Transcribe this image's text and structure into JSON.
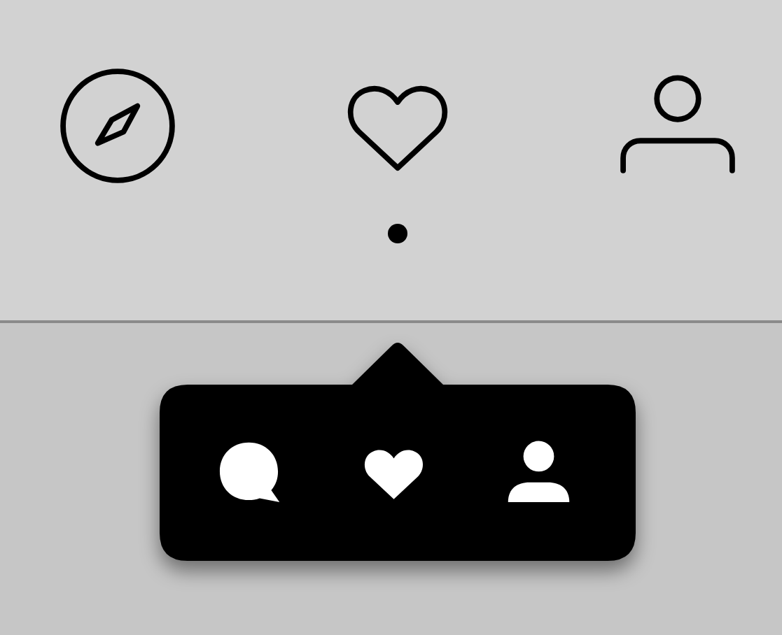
{
  "nav": [
    {
      "kind": "explore",
      "selected": false
    },
    {
      "kind": "activity",
      "selected": true
    },
    {
      "kind": "profile",
      "selected": false
    }
  ],
  "activity_popup": {
    "items": [
      {
        "kind": "comment"
      },
      {
        "kind": "like"
      },
      {
        "kind": "follow"
      }
    ]
  }
}
